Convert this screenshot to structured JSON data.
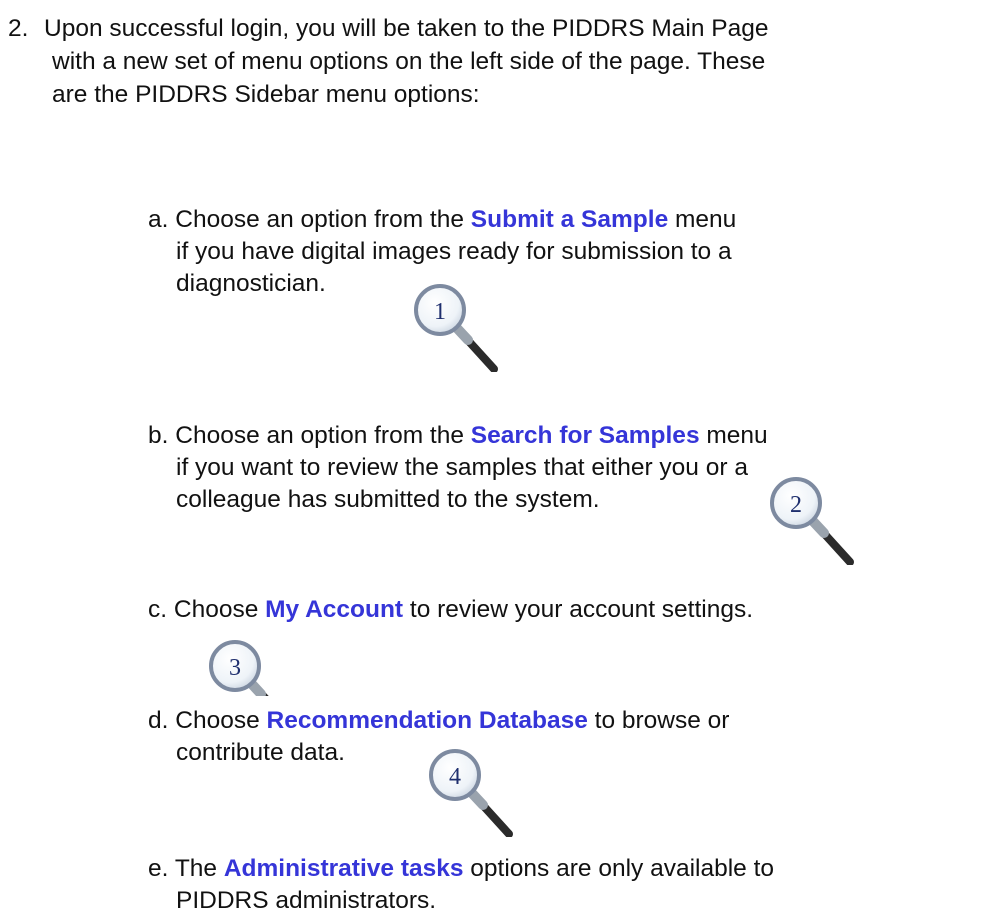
{
  "intro": {
    "number": "2.",
    "lines": [
      "Upon successful login, you will be taken to the PIDDRS Main Page",
      "with a new set of menu options on the left side of the page.  These",
      "are the PIDDRS Sidebar menu options:"
    ]
  },
  "items": [
    {
      "letter": "a.",
      "pre": "Choose an option from the ",
      "highlight": "Submit a Sample",
      "post": " menu",
      "line2": "if you have digital images ready for submission to a",
      "line3": "diagnostician.",
      "badge": "1"
    },
    {
      "letter": "b.",
      "pre": "Choose an option from the ",
      "highlight": "Search for Samples",
      "post": " menu",
      "line2": "if you want to review the samples that either you or a",
      "line3": "colleague has submitted to the system.",
      "badge": "2"
    },
    {
      "letter": "c.",
      "pre": "Choose ",
      "highlight": "My Account",
      "post": " to review your account settings.",
      "badge": "3"
    },
    {
      "letter": "d.",
      "pre": "Choose ",
      "highlight": "Recommendation Database",
      "post": " to browse or",
      "line2": "contribute data.",
      "badge": "4"
    },
    {
      "letter": "e.",
      "pre": "The ",
      "highlight": "Administrative tasks",
      "post": " options are only available to",
      "line2": "PIDDRS administrators."
    }
  ],
  "colors": {
    "highlight": "#3535d8",
    "text": "#111111",
    "lens_rim": "#7d8aa0",
    "handle": "#2b2b2b"
  },
  "icon": "magnifying-glass-icon"
}
